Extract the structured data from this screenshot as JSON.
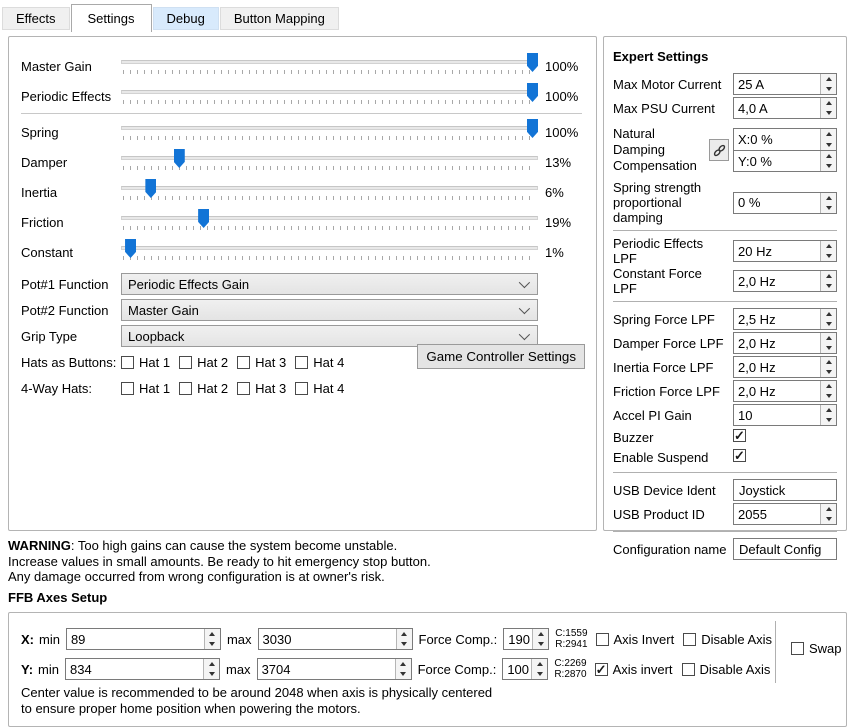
{
  "colors": {
    "accent": "#1274d6",
    "tab_highlight": "#d8eafc"
  },
  "tabs": [
    {
      "label": "Effects"
    },
    {
      "label": "Settings"
    },
    {
      "label": "Debug"
    },
    {
      "label": "Button Mapping"
    }
  ],
  "gains": {
    "sliders": [
      {
        "label": "Master Gain",
        "value": 100,
        "display": "100%"
      },
      {
        "label": "Periodic Effects",
        "value": 100,
        "display": "100%"
      },
      {
        "label": "Spring",
        "value": 100,
        "display": "100%"
      },
      {
        "label": "Damper",
        "value": 13,
        "display": "13%"
      },
      {
        "label": "Inertia",
        "value": 6,
        "display": "6%"
      },
      {
        "label": "Friction",
        "value": 19,
        "display": "19%"
      },
      {
        "label": "Constant",
        "value": 1,
        "display": "1%"
      }
    ],
    "combos": [
      {
        "label": "Pot#1 Function",
        "value": "Periodic Effects Gain"
      },
      {
        "label": "Pot#2 Function",
        "value": "Master Gain"
      },
      {
        "label": "Grip Type",
        "value": "Loopback"
      }
    ],
    "hats_as_buttons": {
      "label": "Hats as Buttons:",
      "options": [
        {
          "label": "Hat 1",
          "checked": false
        },
        {
          "label": "Hat 2",
          "checked": false
        },
        {
          "label": "Hat 3",
          "checked": false
        },
        {
          "label": "Hat 4",
          "checked": false
        }
      ]
    },
    "four_way_hats": {
      "label": "4-Way Hats:",
      "options": [
        {
          "label": "Hat 1",
          "checked": false
        },
        {
          "label": "Hat 2",
          "checked": false
        },
        {
          "label": "Hat 3",
          "checked": false
        },
        {
          "label": "Hat 4",
          "checked": false
        }
      ]
    },
    "game_controller_button": "Game Controller Settings"
  },
  "expert": {
    "title": "Expert Settings",
    "max_motor_current": {
      "label": "Max Motor Current",
      "value": "25 A"
    },
    "max_psu_current": {
      "label": "Max PSU Current",
      "value": "4,0 A"
    },
    "natural_damping": {
      "label": "Natural Damping Compensation",
      "x": "X:0 %",
      "y": "Y:0 %"
    },
    "spring_prop_damping": {
      "label": "Spring strength proportional damping",
      "value": "0 %"
    },
    "periodic_lpf": {
      "label": "Periodic Effects LPF",
      "value": "20 Hz"
    },
    "constant_lpf": {
      "label": "Constant Force LPF",
      "value": "2,0 Hz"
    },
    "spring_lpf": {
      "label": "Spring Force LPF",
      "value": "2,5 Hz"
    },
    "damper_lpf": {
      "label": "Damper Force LPF",
      "value": "2,0 Hz"
    },
    "inertia_lpf": {
      "label": "Inertia Force LPF",
      "value": "2,0 Hz"
    },
    "friction_lpf": {
      "label": "Friction Force LPF",
      "value": "2,0 Hz"
    },
    "accel_pi_gain": {
      "label": "Accel PI Gain",
      "value": "10"
    },
    "buzzer": {
      "label": "Buzzer",
      "checked": true
    },
    "enable_suspend": {
      "label": "Enable Suspend",
      "checked": true
    },
    "usb_device_ident": {
      "label": "USB Device Ident",
      "value": "Joystick"
    },
    "usb_product_id": {
      "label": "USB Product ID",
      "value": "2055"
    },
    "config_name": {
      "label": "Configuration name",
      "value": "Default Config"
    }
  },
  "warning": {
    "bold": "WARNING",
    "rest": ": Too high gains can cause the system become unstable.",
    "line2": "Increase values in small amounts. Be ready to hit emergency stop button.",
    "line3": "Any damage occurred from wrong configuration is at owner's risk."
  },
  "ffb": {
    "title": "FFB Axes Setup",
    "labels": {
      "min": "min",
      "max": "max",
      "force": "Force Comp.:"
    },
    "axes": [
      {
        "axis": "X:",
        "min": "89",
        "max": "3030",
        "force": "190",
        "center": "C:1559",
        "range": "R:2941",
        "invert_label": "Axis Invert",
        "invert_checked": false,
        "disable_label": "Disable Axis",
        "disable_checked": false
      },
      {
        "axis": "Y:",
        "min": "834",
        "max": "3704",
        "force": "100",
        "center": "C:2269",
        "range": "R:2870",
        "invert_label": "Axis invert",
        "invert_checked": true,
        "disable_label": "Disable Axis",
        "disable_checked": false
      }
    ],
    "swap": {
      "label": "Swap",
      "checked": false
    },
    "note1": "Center value is recommended to be around 2048 when axis is physically centered",
    "note2": "to ensure proper home position when powering the motors."
  }
}
